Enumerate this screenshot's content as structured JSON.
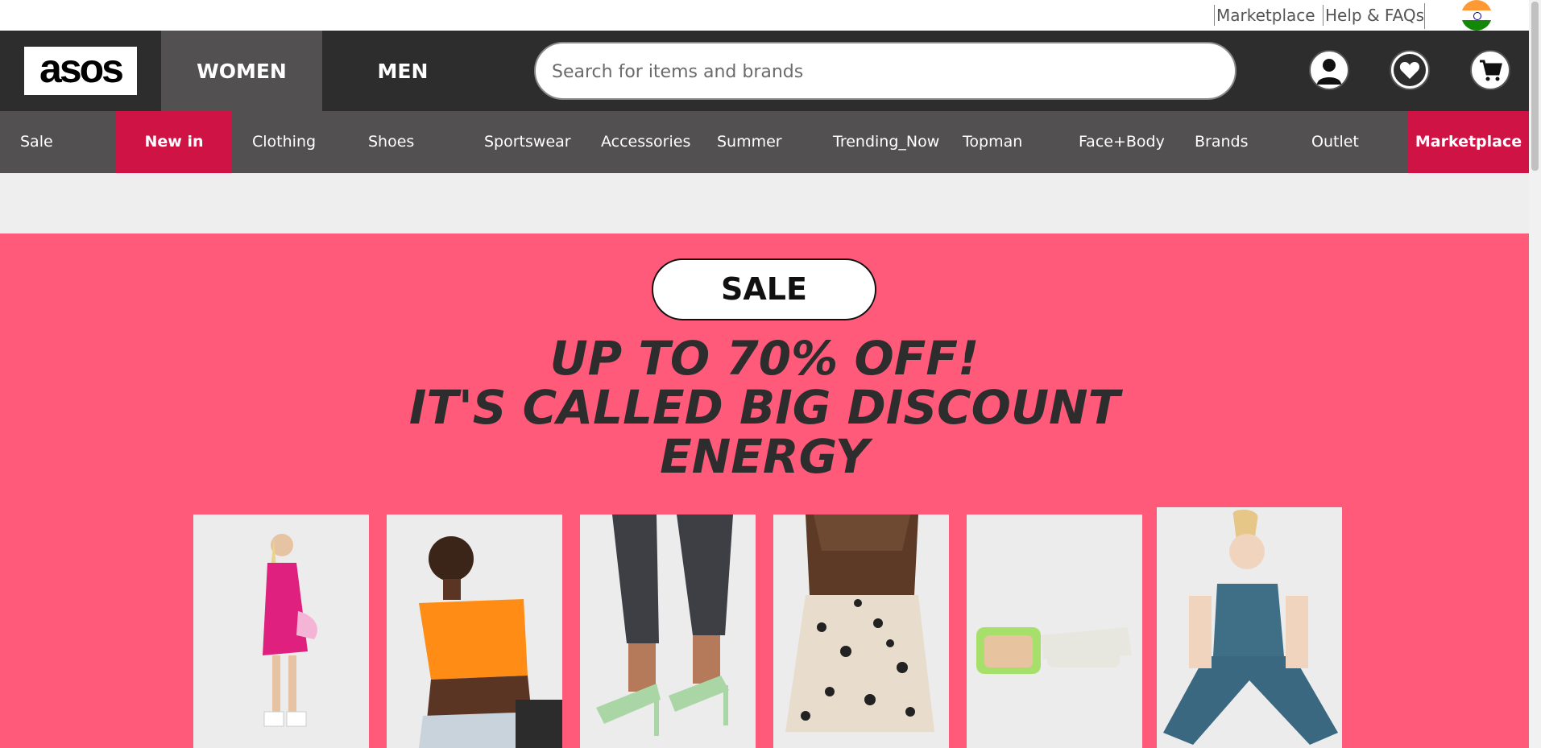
{
  "utility": {
    "marketplace": "Marketplace",
    "help": "Help & FAQs"
  },
  "header": {
    "logo": "asos",
    "tabs": [
      "WOMEN",
      "MEN"
    ],
    "search_placeholder": "Search for items and brands"
  },
  "categories": [
    "Sale",
    "New in",
    "Clothing",
    "Shoes",
    "Sportswear",
    "Accessories",
    "Summer",
    "Trending_Now",
    "Topman",
    "Face+Body",
    "Brands",
    "Outlet",
    "Marketplace"
  ],
  "banner": {
    "pill": "SALE",
    "headline_lines": [
      "UP TO 70% OFF!",
      "IT'S CALLED BIG DISCOUNT",
      "ENERGY"
    ]
  },
  "colors": {
    "header_bg": "#2d2d2d",
    "nav_bg": "#525050",
    "highlight": "#d01345",
    "banner_bg": "#ff5a7a"
  },
  "products": [
    "pink-sequin-dress",
    "orange-crop-top",
    "green-heeled-sandals",
    "leopard-print-shorts",
    "green-sunglasses",
    "teal-activewear-set"
  ]
}
